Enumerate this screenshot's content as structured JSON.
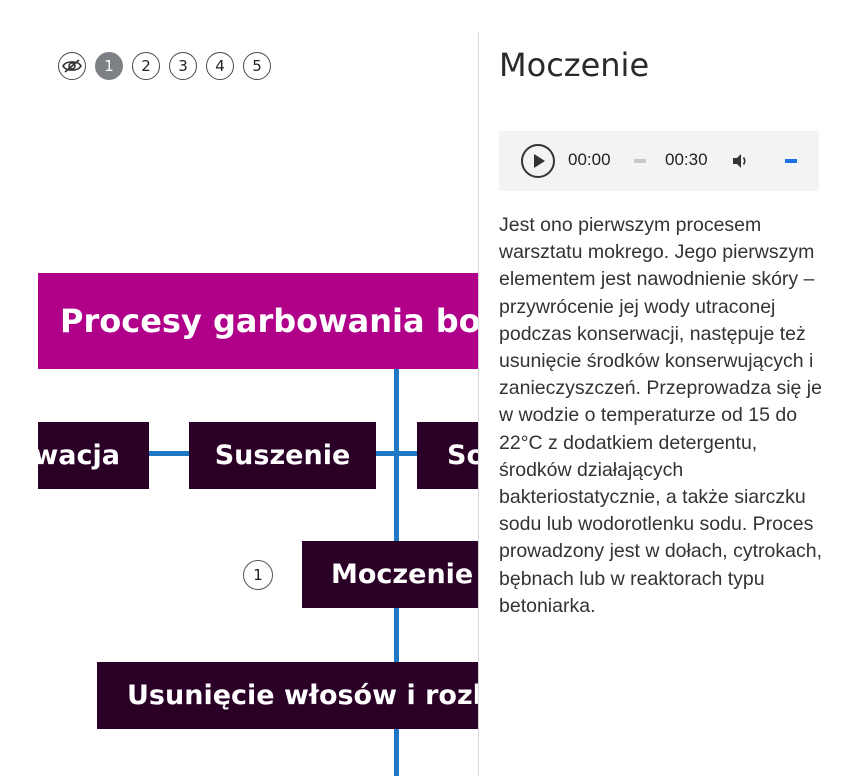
{
  "step_nav": {
    "hide_icon": "eye-slash-icon",
    "steps": [
      "1",
      "2",
      "3",
      "4",
      "5"
    ],
    "active_step": "1"
  },
  "diagram": {
    "title": "Procesy garbowania boków",
    "nodes": {
      "left": "Konserwacja",
      "suszenie": "Suszenie",
      "right": "Solenie",
      "moczenie": "Moczenie",
      "usuniecie": "Usunięcie włosów i rozluźnienie"
    },
    "marker": "1"
  },
  "panel": {
    "title": "Moczenie",
    "audio": {
      "current_time": "00:00",
      "duration": "00:30",
      "progress": 0
    },
    "description": "Jest ono pierwszym procesem warsztatu mokrego. Jego pierwszym elementem jest nawodnienie skóry – przywrócenie jej wody utraconej podczas konserwacji, następuje też usunięcie środków konserwujących i zanieczyszczeń. Przeprowadza się je w wodzie o temperaturze od 15 do 22°C z dodatkiem detergentu, środków działających bakteriostatycznie, a także siarczku sodu lub wodorotlenku sodu. Proces prowadzony jest w dołach, cytrokach, bębnach lub w reaktorach typu betoniarka."
  },
  "colors": {
    "title_box": "#b0008a",
    "node_box": "#2a0026",
    "connector": "#1f78c4",
    "active_step": "#7d8185"
  }
}
